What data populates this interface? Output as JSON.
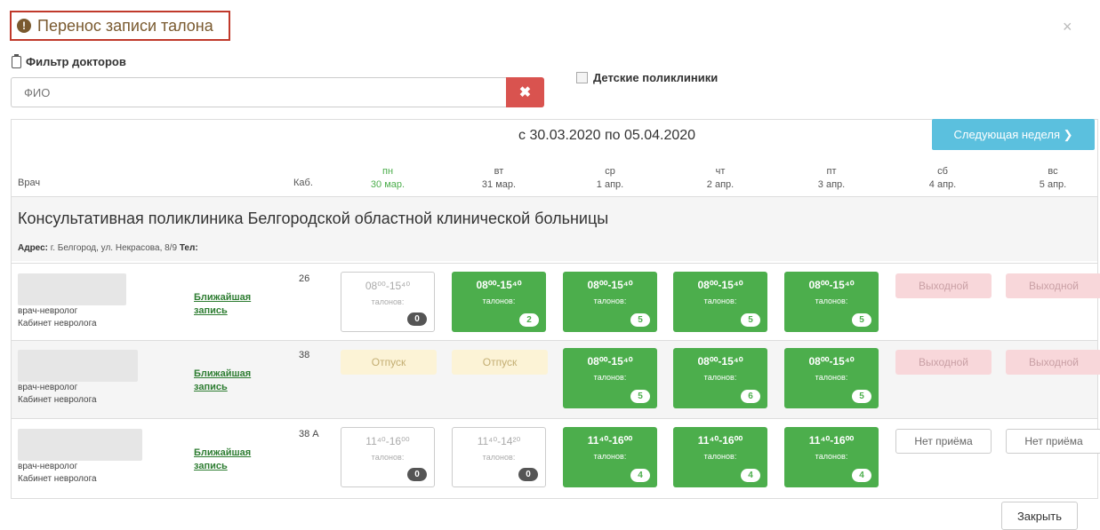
{
  "modal": {
    "title": "Перенос записи талона",
    "close_symbol": "×"
  },
  "filter": {
    "label": "Фильтр докторов",
    "placeholder": "ФИО",
    "clear_symbol": "✖",
    "kids_label": "Детские поликлиники"
  },
  "schedule": {
    "range": "с 30.03.2020 по 05.04.2020",
    "next_week": "Следующая неделя ❯",
    "col_doctor": "Врач",
    "col_cab": "Каб.",
    "days": [
      {
        "d": "пн",
        "date": "30 мар."
      },
      {
        "d": "вт",
        "date": "31 мар."
      },
      {
        "d": "ср",
        "date": "1 апр."
      },
      {
        "d": "чт",
        "date": "2 апр."
      },
      {
        "d": "пт",
        "date": "3 апр."
      },
      {
        "d": "сб",
        "date": "4 апр."
      },
      {
        "d": "вс",
        "date": "5 апр."
      }
    ],
    "clinic": {
      "name": "Консультативная поликлиника Белгородской областной клинической больницы",
      "addr_label": "Адрес:",
      "addr": "г. Белгород, ул. Некрасова, 8/9",
      "tel_label": "Тел:"
    },
    "rows": [
      {
        "role": "врач-невролог",
        "room": "Кабинет невролога",
        "nearest_1": "Ближайшая",
        "nearest_2": "запись",
        "cab": "26",
        "cells": [
          {
            "kind": "white",
            "time": "08⁰⁰-15⁴⁰",
            "lbl": "талонов:",
            "cnt": "0"
          },
          {
            "kind": "green",
            "time": "08⁰⁰-15⁴⁰",
            "lbl": "талонов:",
            "cnt": "2"
          },
          {
            "kind": "green",
            "time": "08⁰⁰-15⁴⁰",
            "lbl": "талонов:",
            "cnt": "5"
          },
          {
            "kind": "green",
            "time": "08⁰⁰-15⁴⁰",
            "lbl": "талонов:",
            "cnt": "5"
          },
          {
            "kind": "green",
            "time": "08⁰⁰-15⁴⁰",
            "lbl": "талонов:",
            "cnt": "5"
          },
          {
            "kind": "off",
            "text": "Выходной"
          },
          {
            "kind": "off",
            "text": "Выходной"
          }
        ]
      },
      {
        "role": "врач-невролог",
        "room": "Кабинет невролога",
        "nearest_1": "Ближайшая",
        "nearest_2": "запись",
        "cab": "38",
        "cells": [
          {
            "kind": "vac",
            "text": "Отпуск"
          },
          {
            "kind": "vac",
            "text": "Отпуск"
          },
          {
            "kind": "green",
            "time": "08⁰⁰-15⁴⁰",
            "lbl": "талонов:",
            "cnt": "5"
          },
          {
            "kind": "green",
            "time": "08⁰⁰-15⁴⁰",
            "lbl": "талонов:",
            "cnt": "6"
          },
          {
            "kind": "green",
            "time": "08⁰⁰-15⁴⁰",
            "lbl": "талонов:",
            "cnt": "5"
          },
          {
            "kind": "off",
            "text": "Выходной"
          },
          {
            "kind": "off",
            "text": "Выходной"
          }
        ]
      },
      {
        "role": "врач-невролог",
        "room": "Кабинет невролога",
        "nearest_1": "Ближайшая",
        "nearest_2": "запись",
        "cab": "38 А",
        "cells": [
          {
            "kind": "white",
            "time": "11⁴⁰-16⁰⁰",
            "lbl": "талонов:",
            "cnt": "0"
          },
          {
            "kind": "white",
            "time": "11⁴⁰-14²⁰",
            "lbl": "талонов:",
            "cnt": "0"
          },
          {
            "kind": "green",
            "time": "11⁴⁰-16⁰⁰",
            "lbl": "талонов:",
            "cnt": "4"
          },
          {
            "kind": "green",
            "time": "11⁴⁰-16⁰⁰",
            "lbl": "талонов:",
            "cnt": "4"
          },
          {
            "kind": "green",
            "time": "11⁴⁰-16⁰⁰",
            "lbl": "талонов:",
            "cnt": "4"
          },
          {
            "kind": "none",
            "text": "Нет приёма"
          },
          {
            "kind": "none",
            "text": "Нет приёма"
          }
        ]
      }
    ]
  },
  "footer": {
    "close": "Закрыть"
  },
  "colors": {
    "green": "#4cae4c",
    "info": "#5bc0de",
    "danger": "#d9534f",
    "title": "#7a5a2f",
    "highlight_border": "#c0392b"
  }
}
